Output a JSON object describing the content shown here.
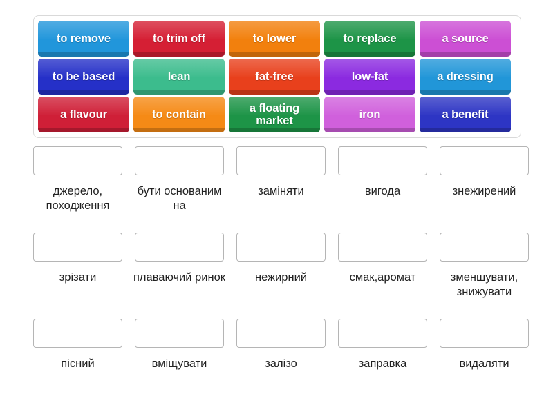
{
  "activity": {
    "type": "match-up-drag-and-drop",
    "tile_bank": {
      "rows": [
        [
          {
            "label": "to remove",
            "color": "#2196db"
          },
          {
            "label": "to trim off",
            "color": "#d51f34"
          },
          {
            "label": "to lower",
            "color": "#f2800d"
          },
          {
            "label": "to replace",
            "color": "#1d9447"
          },
          {
            "label": "a source",
            "color": "#cc4fd4"
          }
        ],
        [
          {
            "label": "to be based",
            "color": "#2530c8"
          },
          {
            "label": "lean",
            "color": "#3cbc8d"
          },
          {
            "label": "fat-free",
            "color": "#e8401c"
          },
          {
            "label": "low-fat",
            "color": "#8b2ae0"
          },
          {
            "label": "a dressing",
            "color": "#2196d8"
          }
        ],
        [
          {
            "label": "a flavour",
            "color": "#cf1f37"
          },
          {
            "label": "to contain",
            "color": "#f58a16"
          },
          {
            "label": "a floating market",
            "color": "#1d9447"
          },
          {
            "label": "iron",
            "color": "#d060dc"
          },
          {
            "label": "a benefit",
            "color": "#2d35c4"
          }
        ]
      ]
    },
    "answer_grid": {
      "rows": [
        [
          {
            "dropzone_value": "",
            "label": "джерело, походження"
          },
          {
            "dropzone_value": "",
            "label": "бути основаним на"
          },
          {
            "dropzone_value": "",
            "label": "заміняти"
          },
          {
            "dropzone_value": "",
            "label": "вигода"
          },
          {
            "dropzone_value": "",
            "label": "знежирений"
          }
        ],
        [
          {
            "dropzone_value": "",
            "label": "зрізати"
          },
          {
            "dropzone_value": "",
            "label": "плаваючий ринок"
          },
          {
            "dropzone_value": "",
            "label": "нежирний"
          },
          {
            "dropzone_value": "",
            "label": "смак,аромат"
          },
          {
            "dropzone_value": "",
            "label": "зменшувати, знижувати"
          }
        ],
        [
          {
            "dropzone_value": "",
            "label": "пісний"
          },
          {
            "dropzone_value": "",
            "label": "вміщувати"
          },
          {
            "dropzone_value": "",
            "label": "залізо"
          },
          {
            "dropzone_value": "",
            "label": "заправка"
          },
          {
            "dropzone_value": "",
            "label": "видаляти"
          }
        ]
      ]
    },
    "colors": {
      "panel_border": "#d9d9d9",
      "dropzone_border": "#b5b5b5",
      "label_text": "#222222",
      "background": "#ffffff"
    }
  }
}
